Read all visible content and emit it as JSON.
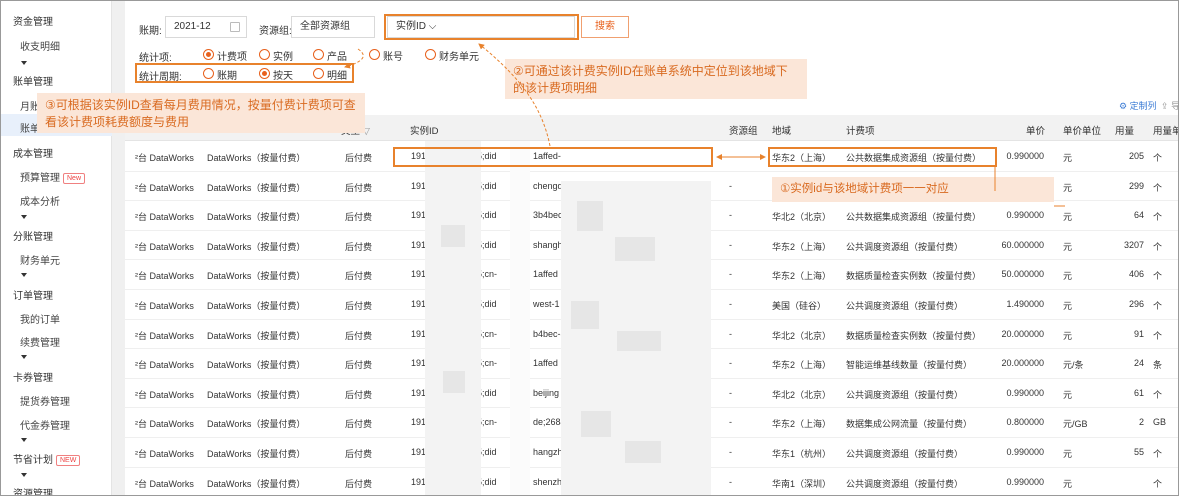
{
  "sidebar": {
    "groups": [
      {
        "label": "资金管理",
        "items": [
          "收支明细"
        ]
      },
      {
        "label": "账单管理",
        "items": [
          "月账单",
          "账单详情"
        ]
      },
      {
        "label": "成本管理",
        "items": [
          "预算管理",
          "成本分析"
        ]
      },
      {
        "label": "分账管理",
        "items": [
          "财务单元"
        ]
      },
      {
        "label": "订单管理",
        "items": [
          "我的订单",
          "续费管理"
        ]
      },
      {
        "label": "卡券管理",
        "items": [
          "提货券管理",
          "代金券管理"
        ]
      },
      {
        "label": "节省计划",
        "items": []
      },
      {
        "label": "资源管理",
        "items": []
      }
    ],
    "new_badge": "New",
    "new_badge_caps": "NEW",
    "visible_partial": {
      "month_bill": "月账",
      "bill_detail": "账单"
    }
  },
  "filters": {
    "period_label": "账期:",
    "period_value": "2021-12",
    "resource_group_label": "资源组:",
    "resource_group_value": "全部资源组",
    "instance_select": "实例ID",
    "search_button": "搜索",
    "stat_label": "统计项:",
    "stat_options": [
      "计费项",
      "实例",
      "产品",
      "账号",
      "财务单元"
    ],
    "stat_selected": 0,
    "cycle_label": "统计周期:",
    "cycle_options": [
      "账期",
      "按天",
      "明细"
    ],
    "cycle_selected": 1
  },
  "annotations": {
    "note1": "①实例id与该地域计费项一一对应",
    "note2": "②可通过该计费实例ID在账单系统中定位到该地域下的该计费项明细",
    "note3": "③可根据该实例ID查看每月费用情况，按量付费计费项可查看该计费项耗费额度与费用"
  },
  "toolbar": {
    "customize_columns": "定制列",
    "export": "导"
  },
  "table": {
    "headers": [
      "实例ID",
      "资源组",
      "地域",
      "计费项",
      "单价",
      "单价单位",
      "用量",
      "用量单"
    ],
    "header_partial_type": "类型",
    "rows": [
      {
        "c1": "²台 DataWorks",
        "c2": "DataWorks（按量付费）",
        "c3": "后付费",
        "id_a": "191",
        "id_b": "5;did",
        "id_c": "1affed-",
        "rg": "",
        "region": "华东2（上海）",
        "item": "公共数据集成资源组（按量付费）",
        "price": "0.990000",
        "unit": "元",
        "usage": "205",
        "uunit": "个"
      },
      {
        "c1": "²台 DataWorks",
        "c2": "DataWorks（按量付费）",
        "c3": "后付费",
        "id_a": "191",
        "id_b": "5;did",
        "id_c": "chengd",
        "rg": "-",
        "region": "",
        "item": "",
        "price": "",
        "unit": "元",
        "usage": "299",
        "uunit": "个"
      },
      {
        "c1": "²台 DataWorks",
        "c2": "DataWorks（按量付费）",
        "c3": "后付费",
        "id_a": "191",
        "id_b": "5;did",
        "id_c": "3b4bec-",
        "rg": "-",
        "region": "华北2（北京）",
        "item": "公共数据集成资源组（按量付费）",
        "price": "0.990000",
        "unit": "元",
        "usage": "64",
        "uunit": "个"
      },
      {
        "c1": "²台 DataWorks",
        "c2": "DataWorks（按量付费）",
        "c3": "后付费",
        "id_a": "191",
        "id_b": "5;did",
        "id_c": "shangh",
        "rg": "-",
        "region": "华东2（上海）",
        "item": "公共调度资源组（按量付费）",
        "price": "60.000000",
        "unit": "元",
        "usage": "3207",
        "uunit": "个"
      },
      {
        "c1": "²台 DataWorks",
        "c2": "DataWorks（按量付费）",
        "c3": "后付费",
        "id_a": "191",
        "id_b": "5;cn-",
        "id_c": "1affed",
        "rg": "-",
        "region": "华东2（上海）",
        "item": "数据质量检查实例数（按量付费）",
        "price": "50.000000",
        "unit": "元",
        "usage": "406",
        "uunit": "个"
      },
      {
        "c1": "²台 DataWorks",
        "c2": "DataWorks（按量付费）",
        "c3": "后付费",
        "id_a": "191",
        "id_b": "5;did",
        "id_c": "west-1",
        "rg": "-",
        "region": "美国（硅谷）",
        "item": "公共调度资源组（按量付费）",
        "price": "1.490000",
        "unit": "元",
        "usage": "296",
        "uunit": "个"
      },
      {
        "c1": "²台 DataWorks",
        "c2": "DataWorks（按量付费）",
        "c3": "后付费",
        "id_a": "191",
        "id_b": "5;cn-",
        "id_c": "b4bec-5",
        "rg": "-",
        "region": "华北2（北京）",
        "item": "数据质量检查实例数（按量付费）",
        "price": "20.000000",
        "unit": "元",
        "usage": "91",
        "uunit": "个"
      },
      {
        "c1": "²台 DataWorks",
        "c2": "DataWorks（按量付费）",
        "c3": "后付费",
        "id_a": "191",
        "id_b": "5;cn-",
        "id_c": "1affed",
        "rg": "-",
        "region": "华东2（上海）",
        "item": "智能运维基线数量（按量付费）",
        "price": "20.000000",
        "unit": "元/条",
        "usage": "24",
        "uunit": "条"
      },
      {
        "c1": "²台 DataWorks",
        "c2": "DataWorks（按量付费）",
        "c3": "后付费",
        "id_a": "191",
        "id_b": "5;did",
        "id_c": "beijing",
        "rg": "-",
        "region": "华北2（北京）",
        "item": "公共调度资源组（按量付费）",
        "price": "0.990000",
        "unit": "元",
        "usage": "61",
        "uunit": "个"
      },
      {
        "c1": "²台 DataWorks",
        "c2": "DataWorks（按量付费）",
        "c3": "后付费",
        "id_a": "191",
        "id_b": "5;cn-",
        "id_c": "de;2684",
        "rg": "-",
        "region": "华东2（上海）",
        "item": "数据集成公网流量（按量付费）",
        "price": "0.800000",
        "unit": "元/GB",
        "usage": "2",
        "uunit": "GB"
      },
      {
        "c1": "²台 DataWorks",
        "c2": "DataWorks（按量付费）",
        "c3": "后付费",
        "id_a": "191",
        "id_b": "5;did",
        "id_c": "hangzh",
        "rg": "-",
        "region": "华东1（杭州）",
        "item": "公共调度资源组（按量付费）",
        "price": "0.990000",
        "unit": "元",
        "usage": "55",
        "uunit": "个"
      },
      {
        "c1": "²台 DataWorks",
        "c2": "DataWorks（按量付费）",
        "c3": "后付费",
        "id_a": "191",
        "id_b": "5;did",
        "id_c": "shenzh",
        "rg": "-",
        "region": "华南1（深圳）",
        "item": "公共调度资源组（按量付费）",
        "price": "0.990000",
        "unit": "元",
        "usage": "",
        "uunit": "个"
      }
    ]
  }
}
